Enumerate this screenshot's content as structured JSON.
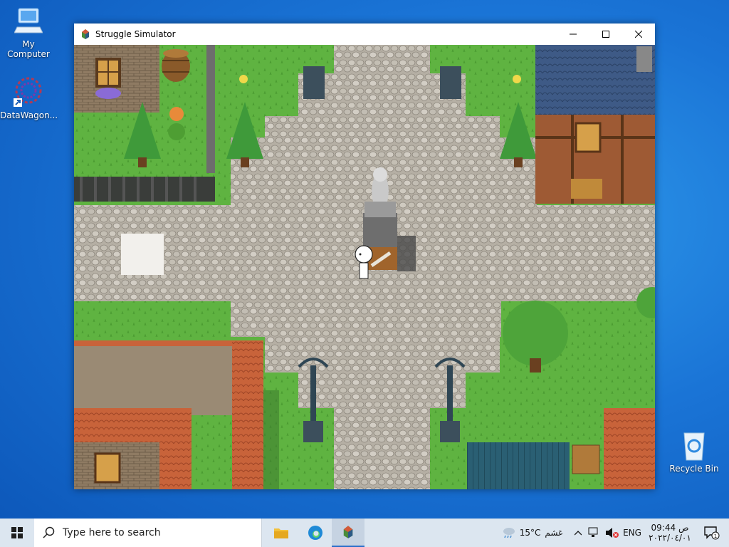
{
  "desktop": {
    "icons": [
      {
        "label": "My Computer"
      },
      {
        "label": "DataWagon..."
      },
      {
        "label": "Recycle Bin"
      }
    ]
  },
  "window": {
    "title": "Struggle Simulator",
    "controls": {
      "minimize": "─",
      "maximize": "☐",
      "close": "✕"
    }
  },
  "game": {
    "scene": "town plaza with stone statue, cobblestone roads, houses, trees, lamp posts",
    "player": "white round-headed stick figure"
  },
  "taskbar": {
    "search_placeholder": "Type here to search",
    "weather_temp": "15°C",
    "weather_text": "غشم",
    "language": "ENG",
    "clock_time": "09:44 ص",
    "clock_date": "٢٠٢٢/٠٤/٠١",
    "notification_count": "1"
  },
  "colors": {
    "grass": "#5fb341",
    "cobble": "#b9b3a8",
    "roof_orange": "#c8633a",
    "roof_blue": "#3e5a86",
    "roof_teal": "#2a5f73",
    "taskbar": "#dce6f0",
    "accent": "#2a6fc9"
  }
}
